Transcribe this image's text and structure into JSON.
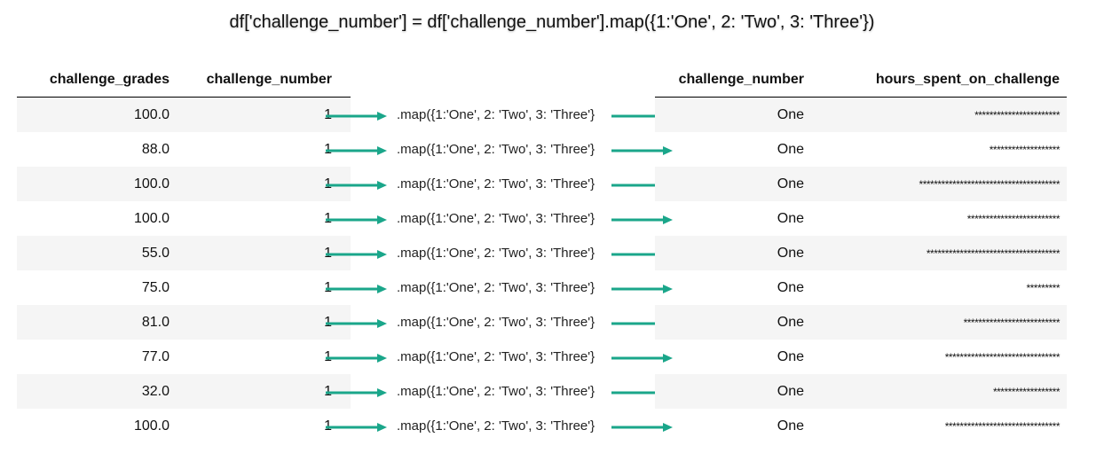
{
  "title": "df['challenge_number'] = df['challenge_number'].map({1:'One', 2: 'Two', 3: 'Three'})",
  "left_table": {
    "headers": [
      "challenge_grades",
      "challenge_number"
    ],
    "rows": [
      [
        "100.0",
        "1"
      ],
      [
        "88.0",
        "1"
      ],
      [
        "100.0",
        "1"
      ],
      [
        "100.0",
        "1"
      ],
      [
        "55.0",
        "1"
      ],
      [
        "75.0",
        "1"
      ],
      [
        "81.0",
        "1"
      ],
      [
        "77.0",
        "1"
      ],
      [
        "32.0",
        "1"
      ],
      [
        "100.0",
        "1"
      ]
    ]
  },
  "map_label": ".map({1:'One', 2: 'Two', 3: 'Three'}",
  "right_table": {
    "headers": [
      "challenge_number",
      "hours_spent_on_challenge"
    ],
    "rows": [
      [
        "One",
        "***********************"
      ],
      [
        "One",
        "*******************"
      ],
      [
        "One",
        "**************************************"
      ],
      [
        "One",
        "*************************"
      ],
      [
        "One",
        "************************************"
      ],
      [
        "One",
        "*********"
      ],
      [
        "One",
        "**************************"
      ],
      [
        "One",
        "*******************************"
      ],
      [
        "One",
        "******************"
      ],
      [
        "One",
        "*******************************"
      ]
    ]
  },
  "colors": {
    "arrow": "#1aa68a",
    "stripe": "#f5f5f5"
  },
  "icons": {
    "arrow": "right-arrow-icon"
  }
}
